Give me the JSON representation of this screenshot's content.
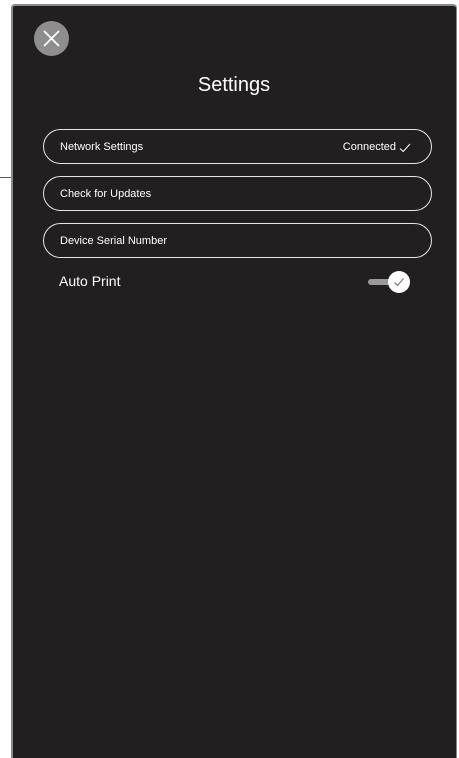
{
  "header": {
    "title": "Settings",
    "close_icon": "close-icon"
  },
  "settings_rows": [
    {
      "label": "Network Settings",
      "status": "Connected",
      "status_icon": "checkmark-icon"
    },
    {
      "label": "Check for Updates"
    },
    {
      "label": "Device Serial Number"
    }
  ],
  "auto_print": {
    "label": "Auto Print",
    "enabled": true,
    "icon": "checkmark-icon"
  },
  "colors": {
    "panel_background": "#231f20",
    "close_button": "#8e8e8e",
    "row_border": "#e6e6e6",
    "toggle_track": "#9a9a9a",
    "text": "#ffffff"
  }
}
